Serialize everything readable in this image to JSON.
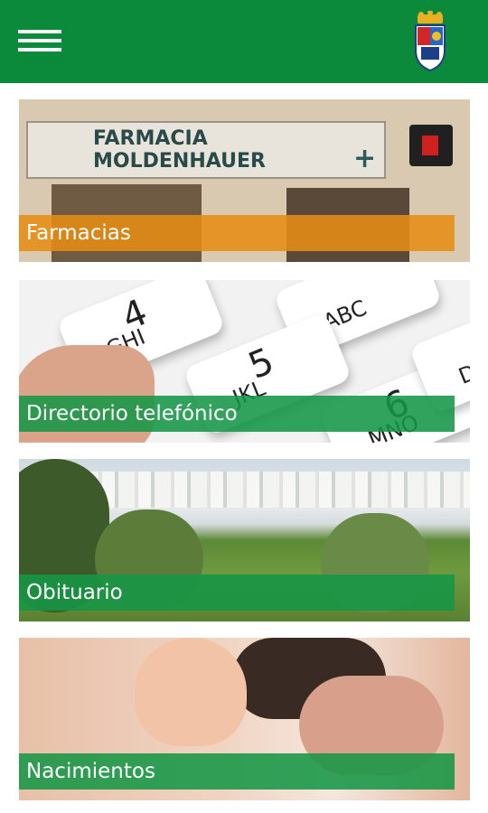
{
  "header": {
    "menu_icon": "hamburger-menu-icon",
    "logo_icon": "municipal-crest-icon",
    "colors": {
      "bar": "#0b8a3c"
    }
  },
  "cards": [
    {
      "label": "Farmacias",
      "label_color": "#e68c14",
      "photo_sign_text": "FARMACIA MOLDENHAUER"
    },
    {
      "label": "Directorio telefónico",
      "label_color": "#169646"
    },
    {
      "label": "Obituario",
      "label_color": "#169646"
    },
    {
      "label": "Nacimientos",
      "label_color": "#169646"
    }
  ],
  "keypad": {
    "keys": [
      {
        "num": "4",
        "letters": "GHI"
      },
      {
        "num": "",
        "letters": "ABC"
      },
      {
        "num": "5",
        "letters": "JKL"
      },
      {
        "num": "6",
        "letters": "MNO"
      },
      {
        "num": "",
        "letters": "DEF"
      }
    ]
  }
}
